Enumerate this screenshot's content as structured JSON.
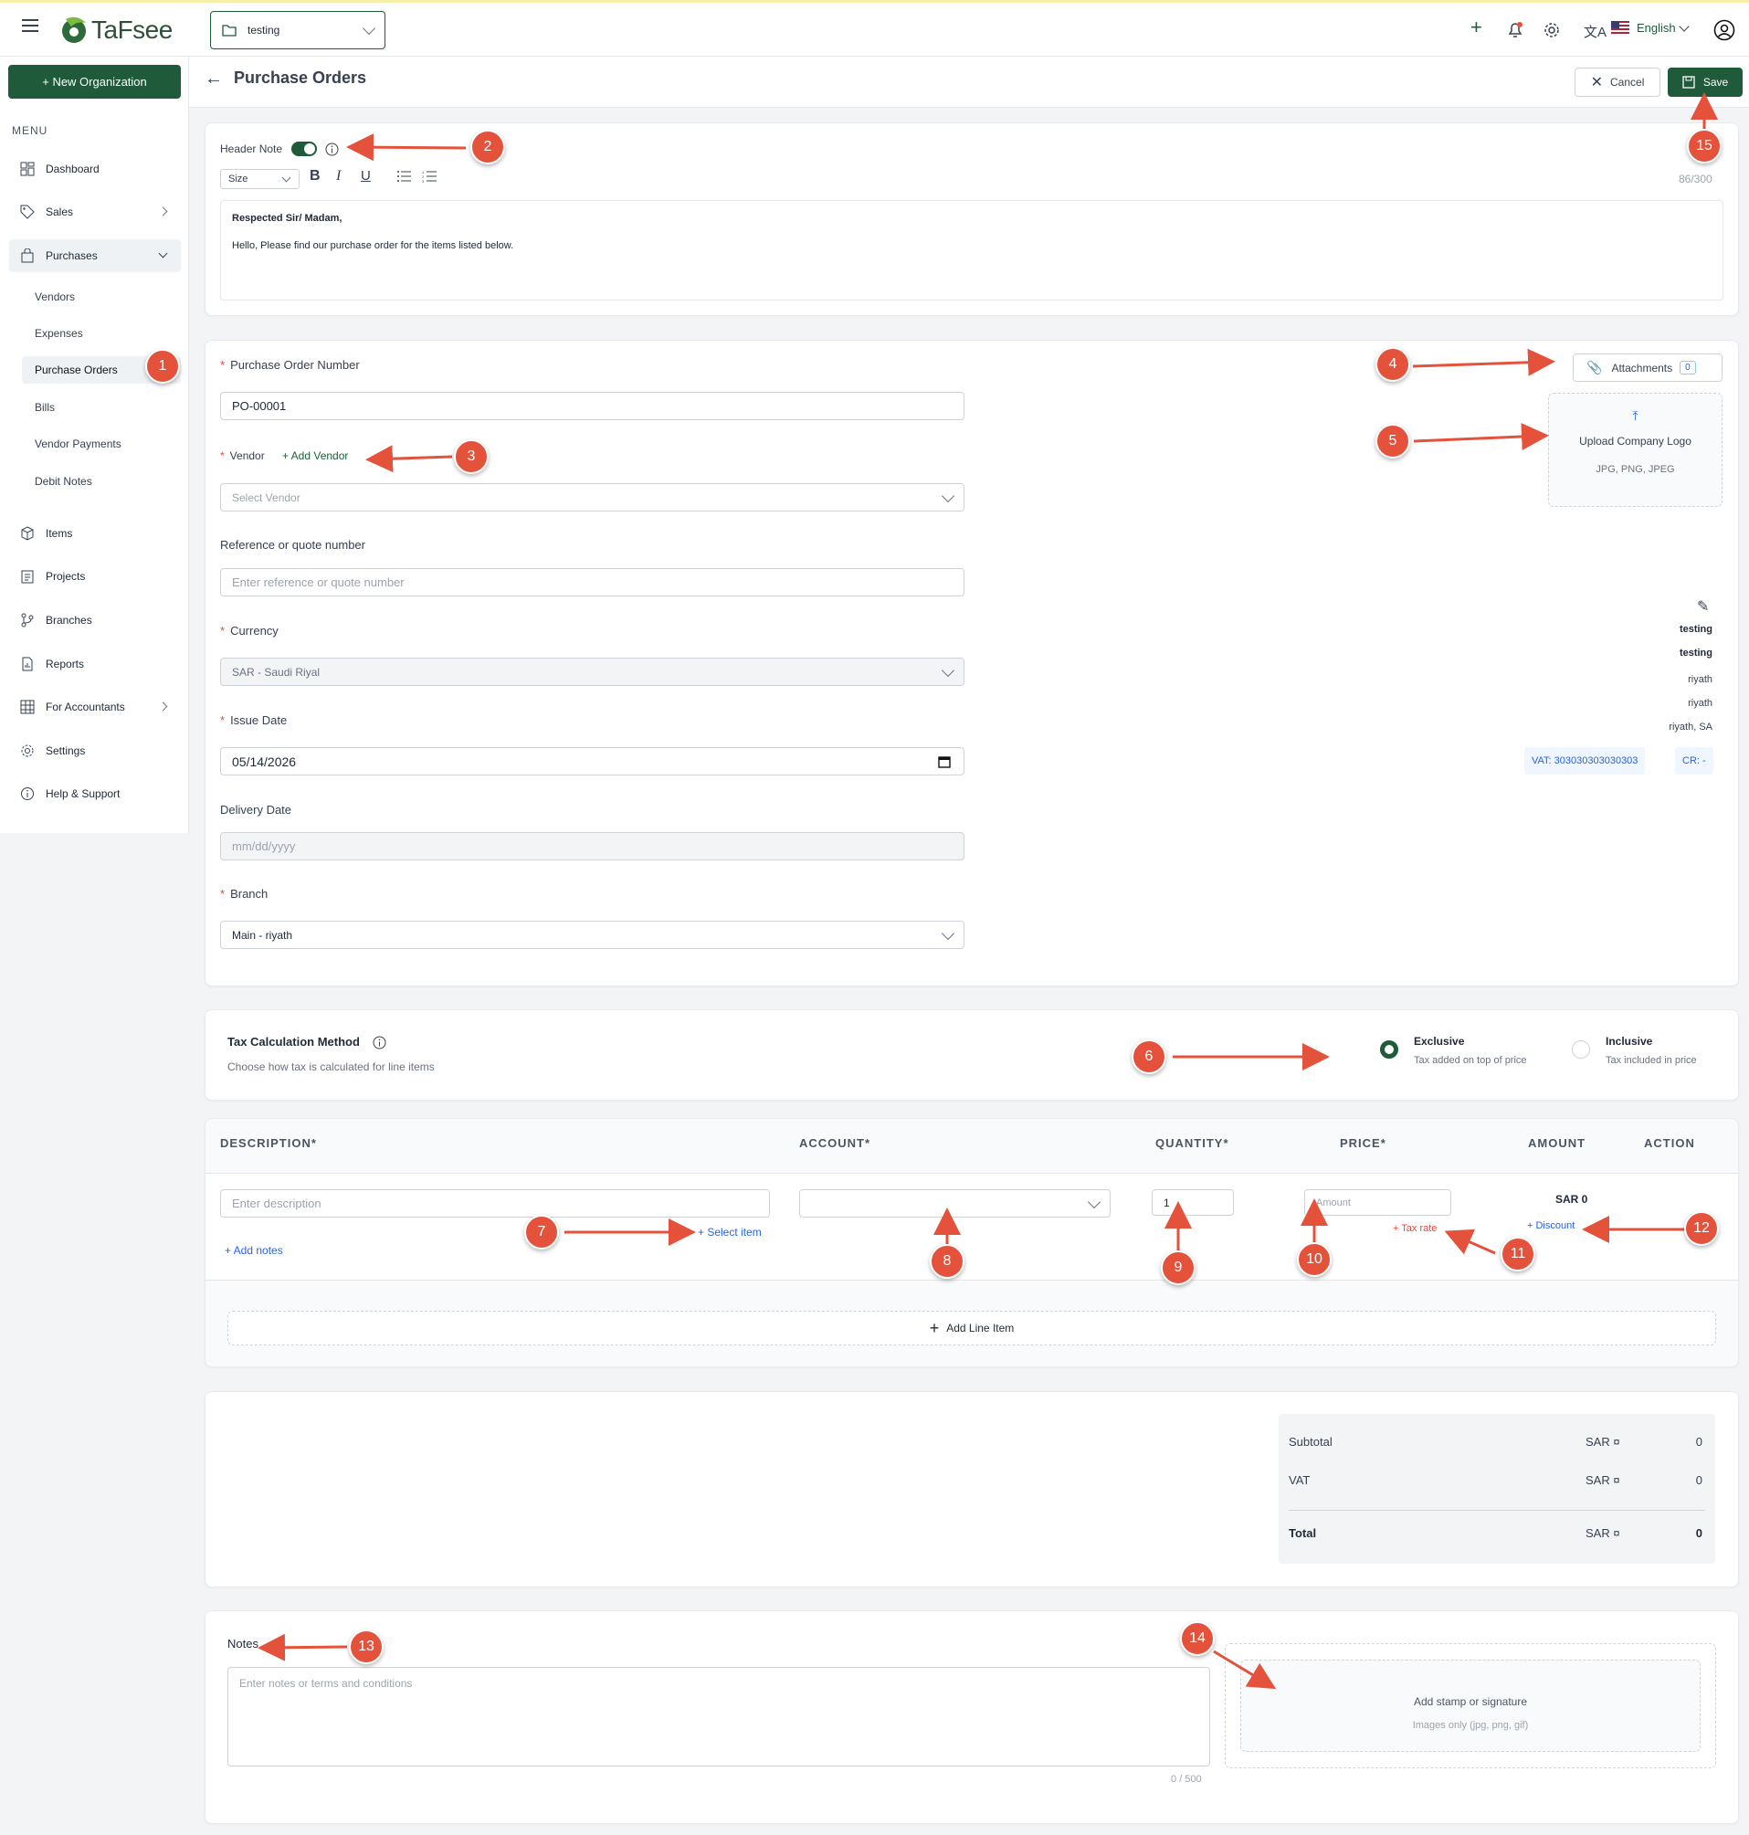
{
  "app": {
    "brand": "TaFsee",
    "org_selector": "testing",
    "language": "English"
  },
  "sidebar": {
    "new_org_label": "+ New Organization",
    "menu_label": "MENU",
    "items": [
      {
        "label": "Dashboard"
      },
      {
        "label": "Sales"
      },
      {
        "label": "Purchases"
      },
      {
        "label": "Items"
      },
      {
        "label": "Projects"
      },
      {
        "label": "Branches"
      },
      {
        "label": "Reports"
      },
      {
        "label": "For Accountants"
      },
      {
        "label": "Settings"
      },
      {
        "label": "Help & Support"
      }
    ],
    "purchases_sub": [
      {
        "label": "Vendors"
      },
      {
        "label": "Expenses"
      },
      {
        "label": "Purchase Orders"
      },
      {
        "label": "Bills"
      },
      {
        "label": "Vendor Payments"
      },
      {
        "label": "Debit Notes"
      }
    ]
  },
  "page": {
    "title": "Purchase Orders",
    "cancel_label": "Cancel",
    "save_label": "Save"
  },
  "header_note": {
    "label": "Header Note",
    "size_placeholder": "Size",
    "counter": "86/300",
    "line1": "Respected Sir/ Madam,",
    "line2": "Hello, Please find our purchase order for the items listed below."
  },
  "form": {
    "po_number_label": "Purchase Order Number",
    "po_number_value": "PO-00001",
    "vendor_label": "Vendor",
    "add_vendor": "+ Add Vendor",
    "vendor_placeholder": "Select Vendor",
    "reference_label": "Reference or quote number",
    "reference_placeholder": "Enter reference or quote number",
    "currency_label": "Currency",
    "currency_value": "SAR - Saudi Riyal",
    "issue_date_label": "Issue Date",
    "issue_date_value": "05/14/2026",
    "delivery_date_label": "Delivery Date",
    "delivery_date_placeholder": "mm/dd/yyyy",
    "branch_label": "Branch",
    "branch_value": "Main - riyath"
  },
  "attachments": {
    "label": "Attachments",
    "count": "0"
  },
  "logo_upload": {
    "title": "Upload Company Logo",
    "formats": "JPG, PNG, JPEG"
  },
  "company": {
    "line1": "testing",
    "line2": "testing",
    "line3": "riyath",
    "line4": "riyath",
    "line5": "riyath, SA",
    "vat": "VAT: 303030303030303",
    "cr": "CR: -"
  },
  "tax": {
    "title": "Tax Calculation Method",
    "subtitle": "Choose how tax is calculated for line items",
    "exclusive_label": "Exclusive",
    "exclusive_desc": "Tax added on top of price",
    "inclusive_label": "Inclusive",
    "inclusive_desc": "Tax included in price"
  },
  "table": {
    "headers": {
      "description": "DESCRIPTION*",
      "account": "ACCOUNT*",
      "quantity": "QUANTITY*",
      "price": "PRICE*",
      "amount": "AMOUNT",
      "action": "ACTION"
    },
    "row": {
      "description_placeholder": "Enter description",
      "select_item": "+ Select item",
      "add_notes": "+ Add notes",
      "quantity": "1",
      "price_placeholder": "Amount",
      "tax_rate": "+ Tax rate",
      "amount": "SAR 0",
      "discount": "+ Discount"
    },
    "add_line_label": "Add Line Item"
  },
  "totals": {
    "subtotal_label": "Subtotal",
    "subtotal_currency": "SAR ¤",
    "subtotal_value": "0",
    "vat_label": "VAT",
    "vat_currency": "SAR ¤",
    "vat_value": "0",
    "total_label": "Total",
    "total_currency": "SAR ¤",
    "total_value": "0"
  },
  "notes": {
    "label": "Notes",
    "placeholder": "Enter notes or terms and conditions",
    "counter": "0 / 500",
    "stamp_title": "Add stamp or signature",
    "stamp_formats": "Images only (jpg, png, gif)"
  },
  "annotations": [
    "1",
    "2",
    "3",
    "4",
    "5",
    "6",
    "7",
    "8",
    "9",
    "10",
    "11",
    "12",
    "13",
    "14",
    "15"
  ],
  "colors": {
    "accent": "#1f5a3a",
    "annotation": "#e4523c",
    "link": "#2563eb"
  }
}
